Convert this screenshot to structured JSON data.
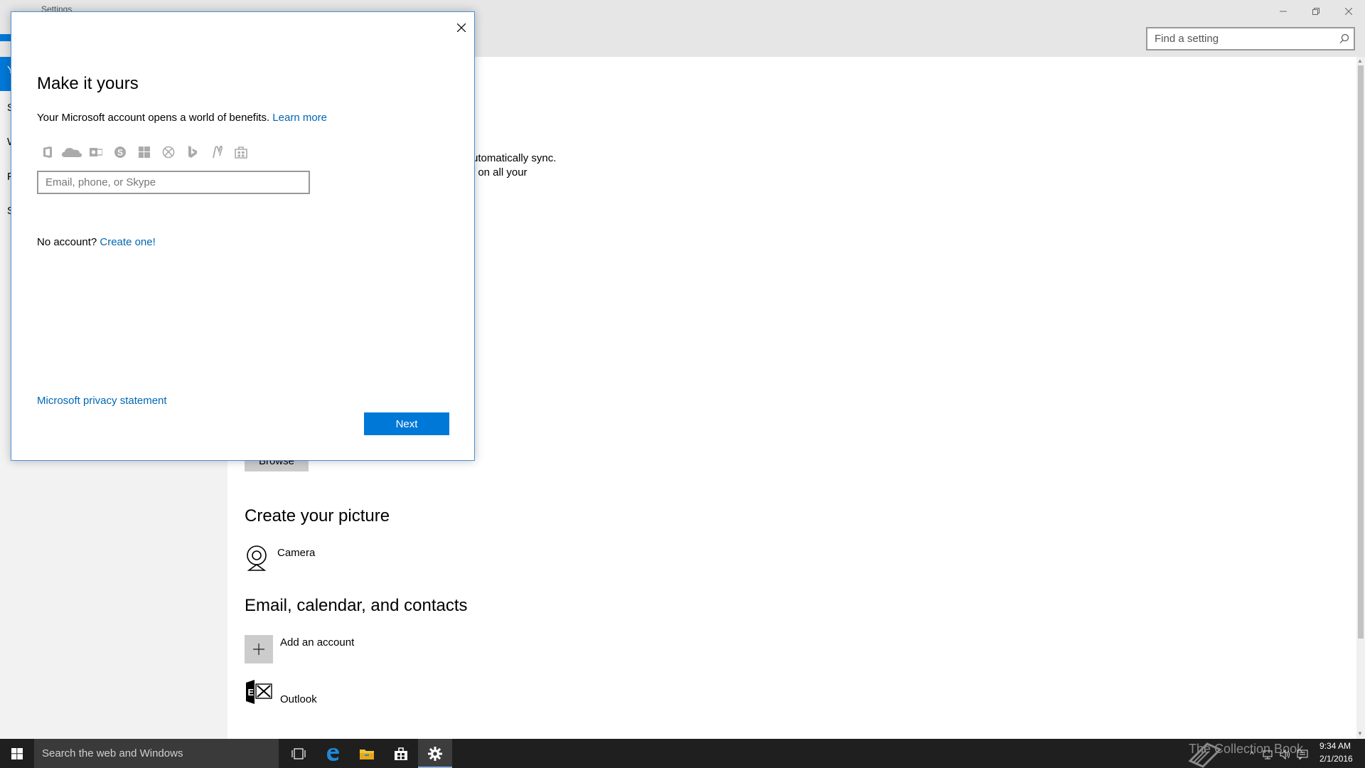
{
  "window": {
    "title": "Settings",
    "back_glyph": "←",
    "minimize_icon": "minimize-icon",
    "maximize_icon": "restore-icon",
    "close_icon": "close-icon"
  },
  "search": {
    "placeholder": "Find a setting",
    "icon": "search-icon"
  },
  "nav": {
    "letters": [
      "Y",
      "S",
      "W",
      "F",
      "S"
    ]
  },
  "content": {
    "partial_line1": "utomatically sync.",
    "partial_line2": "f on all your",
    "browse_label": "Browse",
    "create_picture_title": "Create your picture",
    "camera_label": "Camera",
    "email_section_title": "Email, calendar, and contacts",
    "add_account_label": "Add an account",
    "outlook_label": "Outlook"
  },
  "dialog": {
    "title": "Make it yours",
    "intro_text": "Your Microsoft account opens a world of benefits. ",
    "learn_more": "Learn more",
    "services": [
      "office-icon",
      "onedrive-icon",
      "outlook-icon",
      "skype-icon",
      "windows-icon",
      "xbox-icon",
      "bing-icon",
      "msn-icon",
      "store-icon"
    ],
    "email_placeholder": "Email, phone, or Skype",
    "no_account_text": "No account? ",
    "create_link": "Create one!",
    "privacy_link": "Microsoft privacy statement",
    "next_label": "Next"
  },
  "taskbar": {
    "search_text": "Search the web and Windows",
    "watermark": "The Collection Book",
    "time": "9:34 AM",
    "date": "2/1/2016"
  },
  "colors": {
    "accent": "#0078d7",
    "link": "#0066b4",
    "taskbar": "#1f1f1f"
  }
}
